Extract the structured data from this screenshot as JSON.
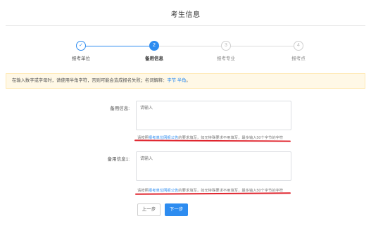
{
  "page": {
    "title": "考生信息"
  },
  "stepper": {
    "steps": [
      {
        "number": "✓",
        "label": "报考单位",
        "state": "done"
      },
      {
        "number": "2",
        "label": "备用信息",
        "state": "active"
      },
      {
        "number": "3",
        "label": "报考专业",
        "state": "todo"
      },
      {
        "number": "4",
        "label": "报考点",
        "state": "todo"
      }
    ]
  },
  "notice": {
    "text": "在输入数字或字母时，请使用半角字符，否则可能会造成报名失败；名词解释：",
    "link1": "字节",
    "link2": "半角",
    "end": "。"
  },
  "fields": [
    {
      "label": "备用信息:",
      "placeholder": "请输入",
      "hint_prefix": "请按照",
      "hint_link": "报考单位网报公告",
      "hint_suffix": "的要求填写，如无特殊要求不用填写，最多输入50个字节的字符"
    },
    {
      "label": "备用信息1:",
      "placeholder": "请输入",
      "hint_prefix": "请按照",
      "hint_link": "报考单位网报公告",
      "hint_suffix": "的要求填写，如无特殊要求不用填写，最多输入50个字节的字符"
    }
  ],
  "buttons": {
    "prev": "上一步",
    "next": "下一步"
  },
  "colors": {
    "accent": "#2d8cf0",
    "notice_bg": "#fff8e6",
    "annotation_red": "#e0252e"
  }
}
